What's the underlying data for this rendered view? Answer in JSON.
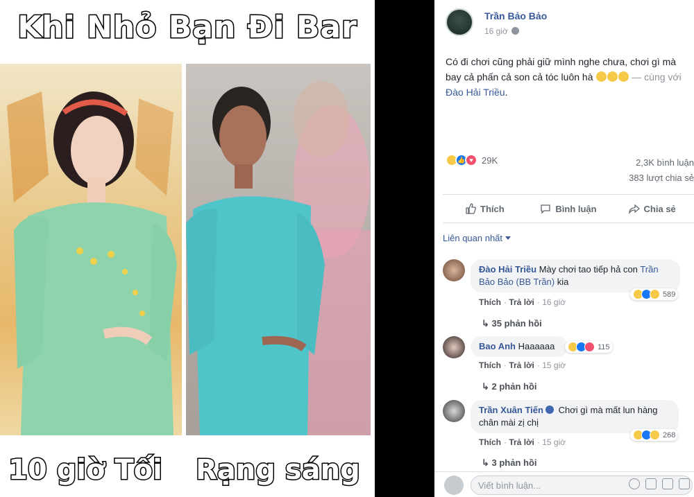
{
  "meme": {
    "title": "Khi Nhỏ Bạn Đi Bar",
    "caption_left": "10 giờ Tối",
    "caption_right": "Rạng sáng"
  },
  "post": {
    "author": "Trần Bảo Bảo",
    "time": "16 giờ",
    "text": "Có đi chơi cũng phải giữ mình nghe chưa, chơi gì mà bay cả phấn cả son cả tóc luôn hà",
    "tag_prefix": "— cùng với",
    "tag_name": "Đào Hải Triều",
    "tag_suffix": ".",
    "reaction_count": "29K",
    "comments_count": "2,3K bình luận",
    "shares_count": "383 lượt chia sẻ"
  },
  "actions": {
    "like": "Thích",
    "comment": "Bình luận",
    "share": "Chia sẻ"
  },
  "sort_label": "Liên quan nhất",
  "comments": [
    {
      "name": "Đào Hải Triều",
      "text_line1": "Mày chơi tao tiếp hả con",
      "mention": "Trần Bảo Bảo (BB Trần)",
      "text_after": "kia",
      "like": "Thích",
      "reply": "Trả lời",
      "time": "16 giờ",
      "reaction_count": "589",
      "replies": "35 phản hồi"
    },
    {
      "name": "Bao Anh",
      "text": "Haaaaaa",
      "like": "Thích",
      "reply": "Trả lời",
      "time": "15 giờ",
      "reaction_count": "115",
      "replies": "2 phản hồi"
    },
    {
      "name": "Trần Xuân Tiến",
      "text": "Chơi gì mà mất lun hàng chân mài zị chị",
      "like": "Thích",
      "reply": "Trả lời",
      "time": "15 giờ",
      "reaction_count": "268",
      "replies": "3 phản hồi"
    }
  ],
  "composer": {
    "placeholder": "Viết bình luận..."
  },
  "colors": {
    "link": "#365899",
    "like_blue": "#1877f2",
    "haha_yellow": "#f7c948",
    "love_red": "#f0506e"
  }
}
